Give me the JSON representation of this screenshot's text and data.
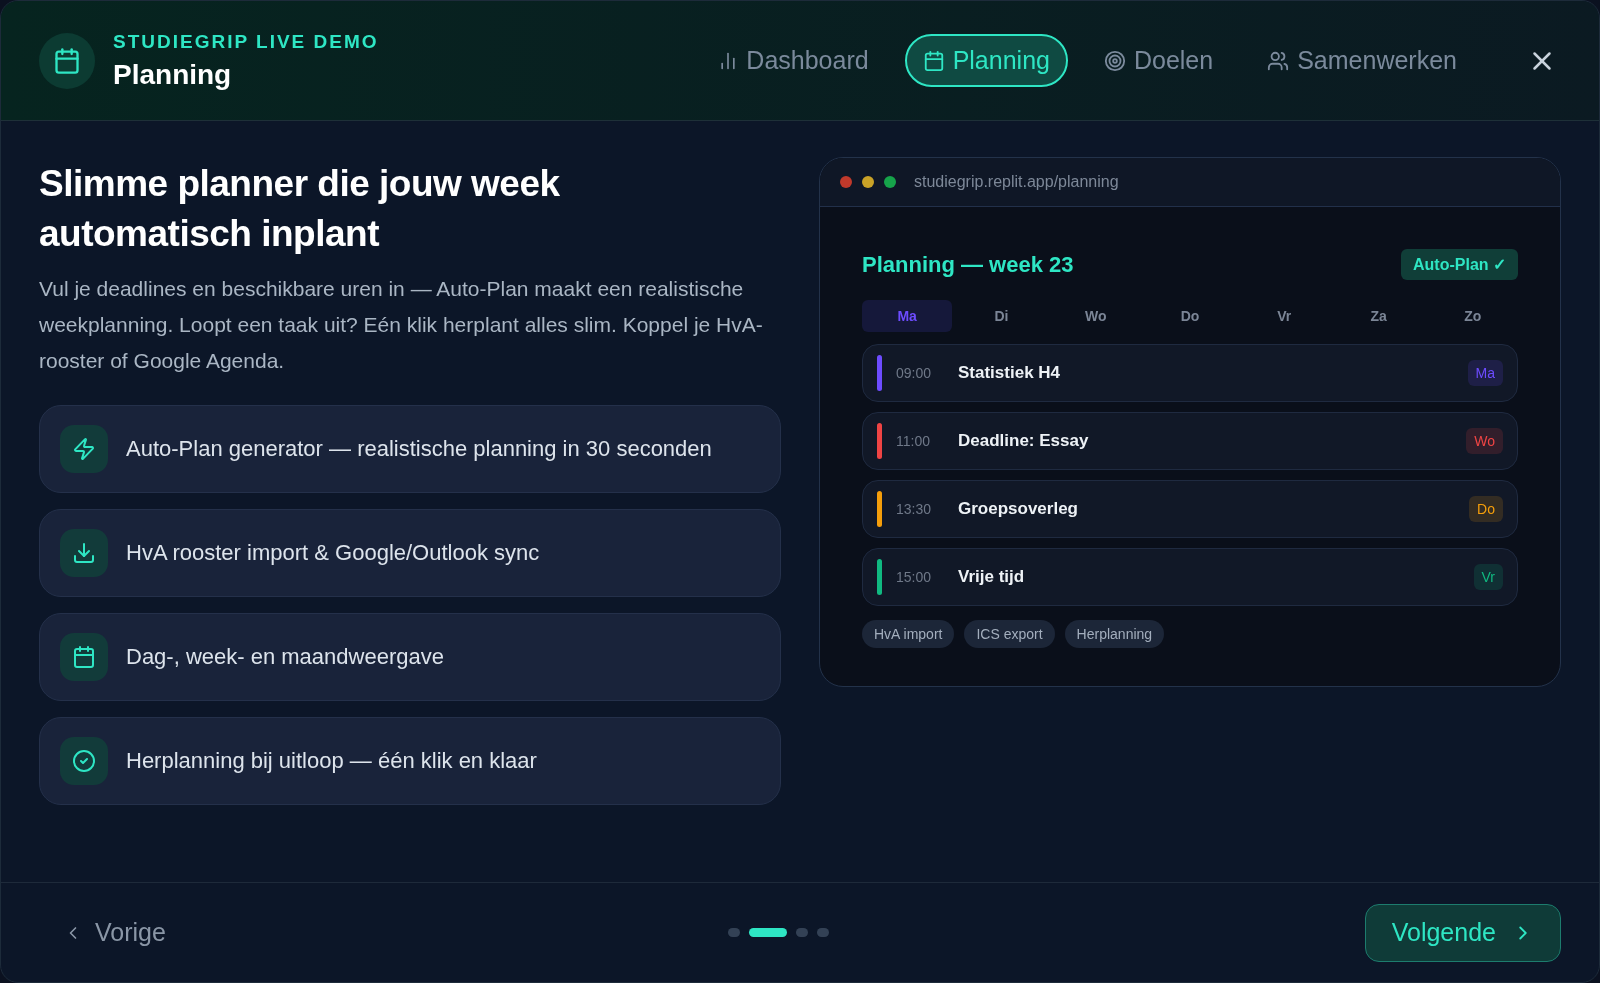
{
  "header": {
    "eyebrow": "STUDIEGRIP LIVE DEMO",
    "title": "Planning"
  },
  "tabs": [
    {
      "label": "Dashboard",
      "selected": false
    },
    {
      "label": "Planning",
      "selected": true
    },
    {
      "label": "Doelen",
      "selected": false
    },
    {
      "label": "Samenwerken",
      "selected": false
    }
  ],
  "intro": {
    "heading": "Slimme planner die jouw week automatisch inplant",
    "text": "Vul je deadlines en beschikbare uren in — Auto-Plan maakt een realistische weekplanning. Loopt een taak uit? Eén klik herplant alles slim. Koppel je HvA-rooster of Google Agenda."
  },
  "features": [
    {
      "text": "Auto-Plan generator — realistische planning in 30 seconden"
    },
    {
      "text": "HvA rooster import & Google/Outlook sync"
    },
    {
      "text": "Dag-, week- en maandweergave"
    },
    {
      "text": "Herplanning bij uitloop — één klik en klaar"
    }
  ],
  "preview": {
    "url": "studiegrip.replit.app/planning",
    "title": "Planning — week 23",
    "badge": "Auto-Plan ✓",
    "days": [
      {
        "label": "Ma",
        "selected": true
      },
      {
        "label": "Di",
        "selected": false
      },
      {
        "label": "Wo",
        "selected": false
      },
      {
        "label": "Do",
        "selected": false
      },
      {
        "label": "Vr",
        "selected": false
      },
      {
        "label": "Za",
        "selected": false
      },
      {
        "label": "Zo",
        "selected": false
      }
    ],
    "events": [
      {
        "time": "09:00",
        "title": "Statistiek H4",
        "day": "Ma",
        "color": "#6d4cff"
      },
      {
        "time": "11:00",
        "title": "Deadline: Essay",
        "day": "Wo",
        "color": "#ef4444"
      },
      {
        "time": "13:30",
        "title": "Groepsoverleg",
        "day": "Do",
        "color": "#f59e0b"
      },
      {
        "time": "15:00",
        "title": "Vrije tijd",
        "day": "Vr",
        "color": "#10b981"
      }
    ],
    "chips": [
      "HvA import",
      "ICS export",
      "Herplanning"
    ]
  },
  "footer": {
    "prev": "Vorige",
    "next": "Volgende",
    "steps": [
      {
        "selected": false
      },
      {
        "selected": true
      },
      {
        "selected": false
      },
      {
        "selected": false
      }
    ]
  }
}
